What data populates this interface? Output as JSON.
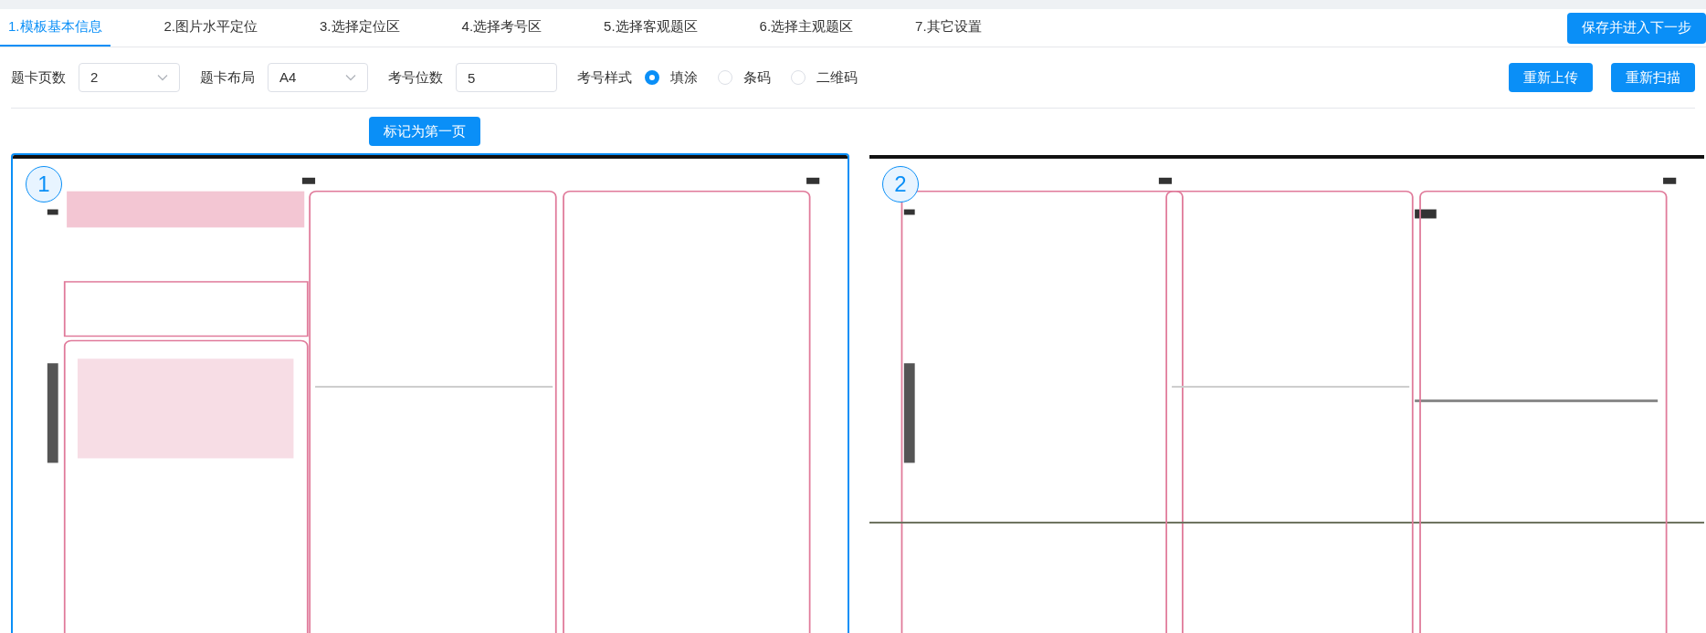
{
  "tabs": [
    {
      "label": "1.模板基本信息",
      "selected": true
    },
    {
      "label": "2.图片水平定位",
      "selected": false
    },
    {
      "label": "3.选择定位区",
      "selected": false
    },
    {
      "label": "4.选择考号区",
      "selected": false
    },
    {
      "label": "5.选择客观题区",
      "selected": false
    },
    {
      "label": "6.选择主观题区",
      "selected": false
    },
    {
      "label": "7.其它设置",
      "selected": false
    }
  ],
  "save_button": "保存并进入下一步",
  "settings": {
    "page_count": {
      "label": "题卡页数",
      "value": "2"
    },
    "layout": {
      "label": "题卡布局",
      "value": "A4"
    },
    "digits": {
      "label": "考号位数",
      "value": "5"
    },
    "style": {
      "label": "考号样式",
      "options": [
        {
          "label": "填涂",
          "selected": true
        },
        {
          "label": "条码",
          "selected": false
        },
        {
          "label": "二维码",
          "selected": false
        }
      ]
    }
  },
  "actions": [
    "重新上传",
    "重新扫描"
  ],
  "mark_button": "标记为第一页",
  "pages": [
    {
      "number": "1",
      "selected": true,
      "kind": "picture"
    },
    {
      "number": "2",
      "selected": false,
      "kind": "picture"
    }
  ]
}
